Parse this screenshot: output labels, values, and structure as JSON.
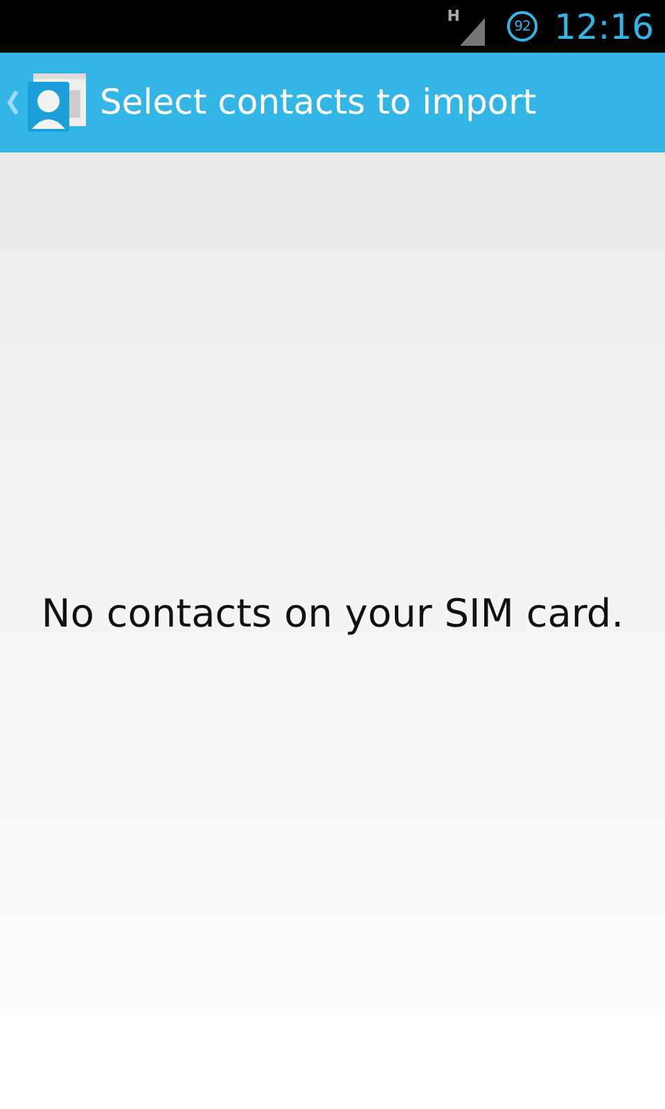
{
  "status_bar": {
    "network_type": "H",
    "battery": "92",
    "time": "12:16"
  },
  "action_bar": {
    "title": "Select contacts to import"
  },
  "empty_message": "No contacts on your SIM card."
}
